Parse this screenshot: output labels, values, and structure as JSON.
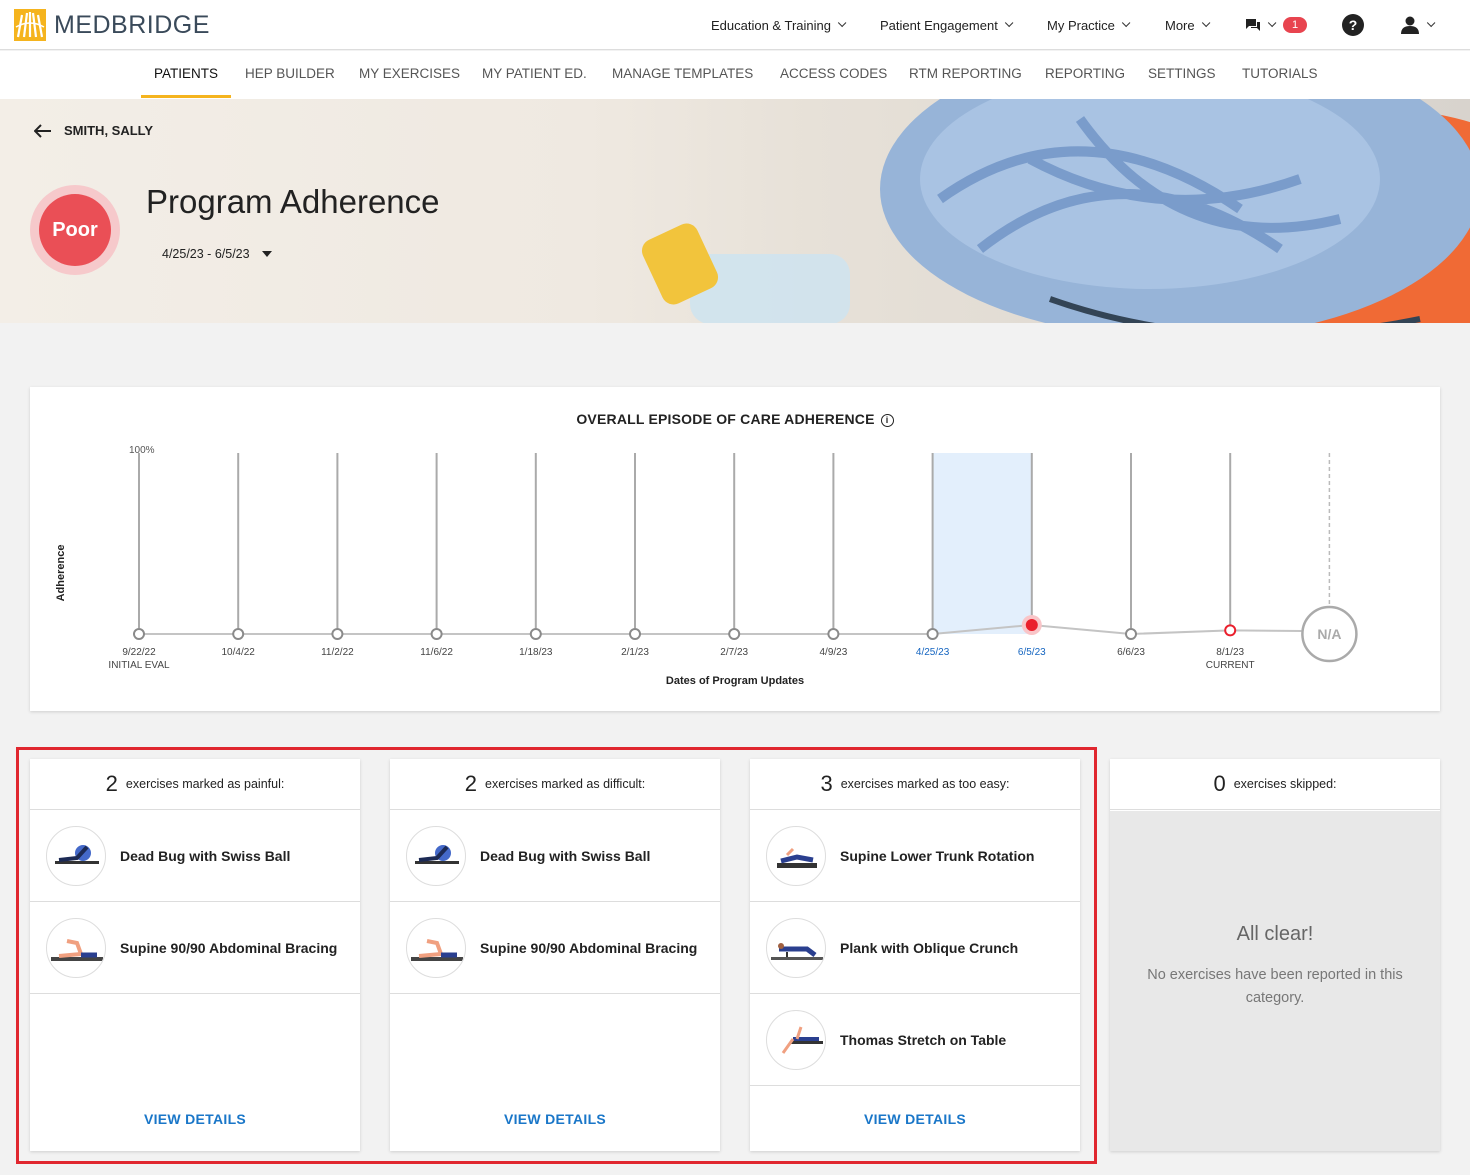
{
  "brand": {
    "name": "MEDBRIDGE",
    "accent": "#f5b41e"
  },
  "topnav": {
    "items": [
      "Education & Training",
      "Patient Engagement",
      "My Practice",
      "More"
    ],
    "notification_count": "1"
  },
  "subnav": {
    "tabs": [
      "PATIENTS",
      "HEP BUILDER",
      "MY EXERCISES",
      "MY PATIENT ED.",
      "MANAGE TEMPLATES",
      "ACCESS CODES",
      "RTM REPORTING",
      "REPORTING",
      "SETTINGS",
      "TUTORIALS"
    ],
    "active": "PATIENTS"
  },
  "header": {
    "patient_name": "SMITH, SALLY",
    "adherence_status": "Poor",
    "title": "Program Adherence",
    "date_range": "4/25/23 - 6/5/23"
  },
  "chart_data": {
    "type": "line",
    "title": "OVERALL EPISODE OF CARE ADHERENCE",
    "ylabel": "Adherence",
    "xlabel": "Dates of Program Updates",
    "ytick_top": "100%",
    "ylim": [
      0,
      100
    ],
    "x": [
      "9/22/22",
      "10/4/22",
      "11/2/22",
      "11/6/22",
      "1/18/23",
      "2/1/23",
      "2/7/23",
      "4/9/23",
      "4/25/23",
      "6/5/23",
      "6/6/23",
      "8/1/23"
    ],
    "x_sublabels": {
      "9/22/22": "INITIAL EVAL",
      "8/1/23": "CURRENT"
    },
    "values": [
      0,
      0,
      0,
      0,
      0,
      0,
      0,
      0,
      0,
      5,
      0,
      2
    ],
    "selected_range": [
      "4/25/23",
      "6/5/23"
    ],
    "current_value_label": "N/A"
  },
  "cards": [
    {
      "count": "2",
      "label": "exercises marked as painful:",
      "exercises": [
        "Dead Bug with Swiss Ball",
        "Supine 90/90 Abdominal Bracing"
      ],
      "action": "VIEW DETAILS"
    },
    {
      "count": "2",
      "label": "exercises marked as difficult:",
      "exercises": [
        "Dead Bug with Swiss Ball",
        "Supine 90/90 Abdominal Bracing"
      ],
      "action": "VIEW DETAILS"
    },
    {
      "count": "3",
      "label": "exercises marked as too easy:",
      "exercises": [
        "Supine Lower Trunk Rotation",
        "Plank with Oblique Crunch",
        "Thomas Stretch on Table"
      ],
      "action": "VIEW DETAILS"
    },
    {
      "count": "0",
      "label": "exercises skipped:",
      "empty_title": "All clear!",
      "empty_text": "No exercises have been reported in this category."
    }
  ]
}
